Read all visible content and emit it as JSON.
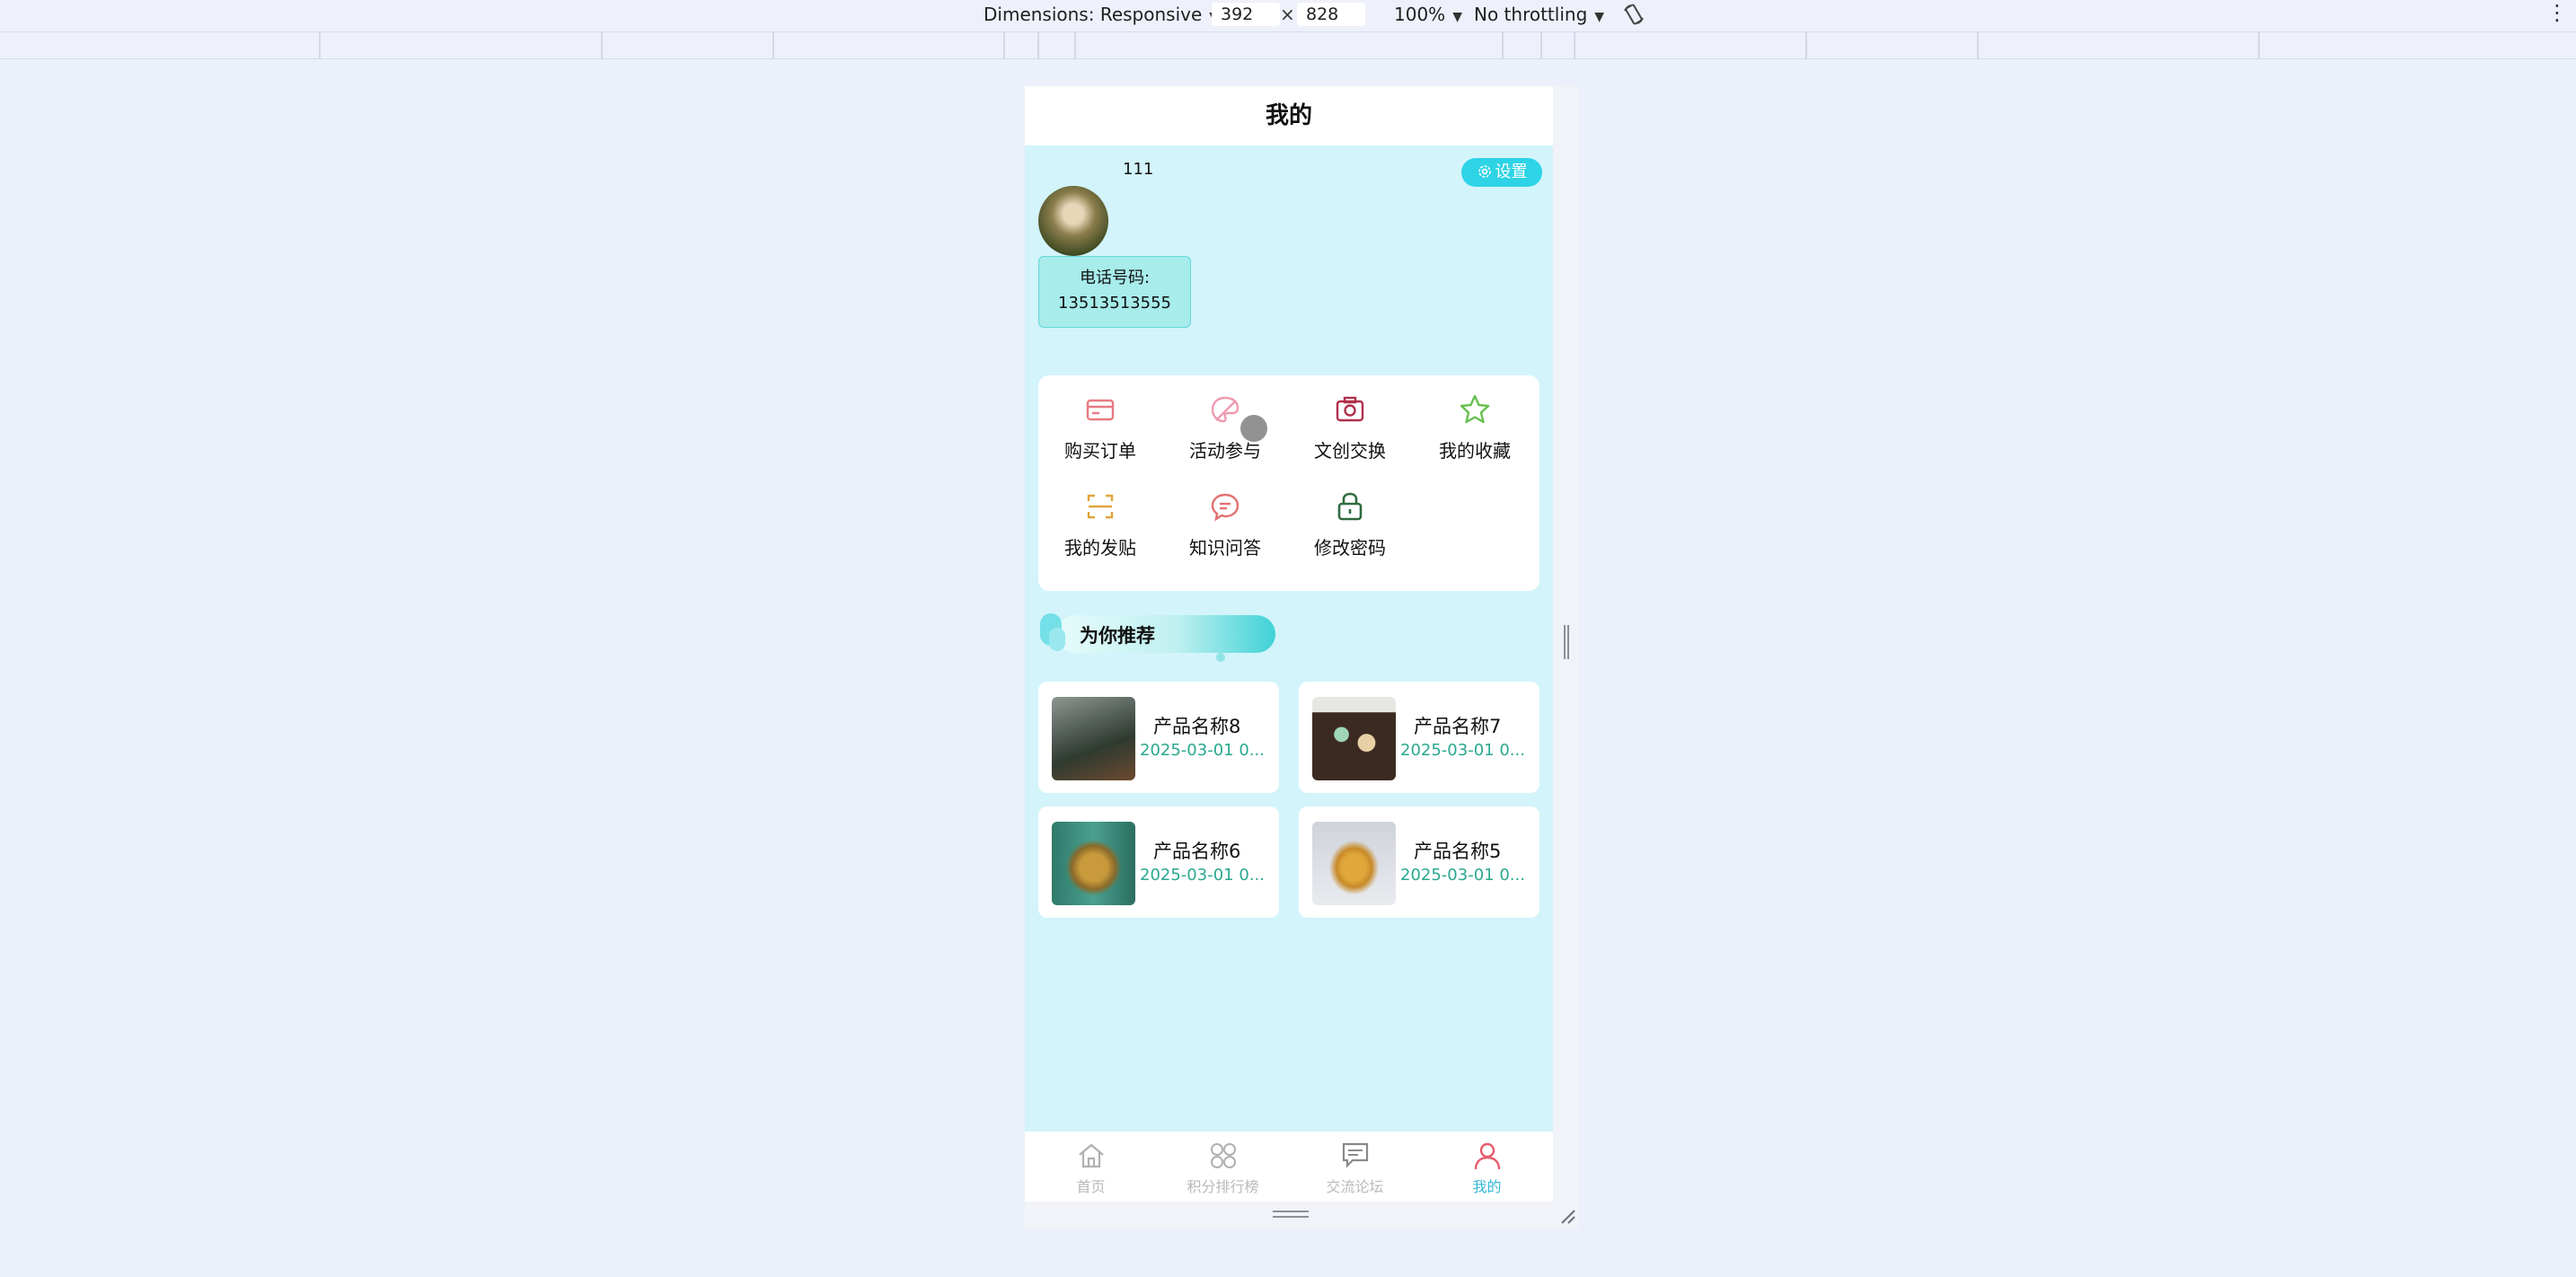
{
  "devtools": {
    "dimensions_label": "Dimensions: Responsive",
    "width": "392",
    "times": "×",
    "height": "828",
    "zoom": "100%",
    "throttling": "No throttling",
    "more": "⋮"
  },
  "page": {
    "title": "我的"
  },
  "profile": {
    "username": "111",
    "settings_label": "设置",
    "phone_label": "电话号码:",
    "phone_value": "13513513555"
  },
  "menu": {
    "items": [
      {
        "label": "购买订单",
        "icon": "card-icon",
        "color": "#e87a82"
      },
      {
        "label": "活动参与",
        "icon": "palette-icon",
        "color": "#ef9ab0"
      },
      {
        "label": "文创交换",
        "icon": "camera-icon",
        "color": "#b0304a"
      },
      {
        "label": "我的收藏",
        "icon": "star-icon",
        "color": "#66c04c"
      },
      {
        "label": "我的发贴",
        "icon": "scan-icon",
        "color": "#e0a43a"
      },
      {
        "label": "知识问答",
        "icon": "chat-icon",
        "color": "#e57070"
      },
      {
        "label": "修改密码",
        "icon": "lock-icon",
        "color": "#2f6b3e"
      }
    ]
  },
  "recommend": {
    "title": "为你推荐",
    "products": [
      {
        "name": "产品名称8",
        "date": "2025-03-01 0..."
      },
      {
        "name": "产品名称7",
        "date": "2025-03-01 0..."
      },
      {
        "name": "产品名称6",
        "date": "2025-03-01 0..."
      },
      {
        "name": "产品名称5",
        "date": "2025-03-01 0..."
      }
    ]
  },
  "tabbar": {
    "tabs": [
      {
        "label": "首页",
        "icon": "home-icon"
      },
      {
        "label": "积分排行榜",
        "icon": "grid-icon"
      },
      {
        "label": "交流论坛",
        "icon": "forum-icon"
      },
      {
        "label": "我的",
        "icon": "user-icon",
        "active": true
      }
    ]
  },
  "colors": {
    "accent": "#2ed3e6",
    "content_bg": "#d3f4fb",
    "date_text": "#2aa88f",
    "tab_active": "#37b8d9"
  }
}
